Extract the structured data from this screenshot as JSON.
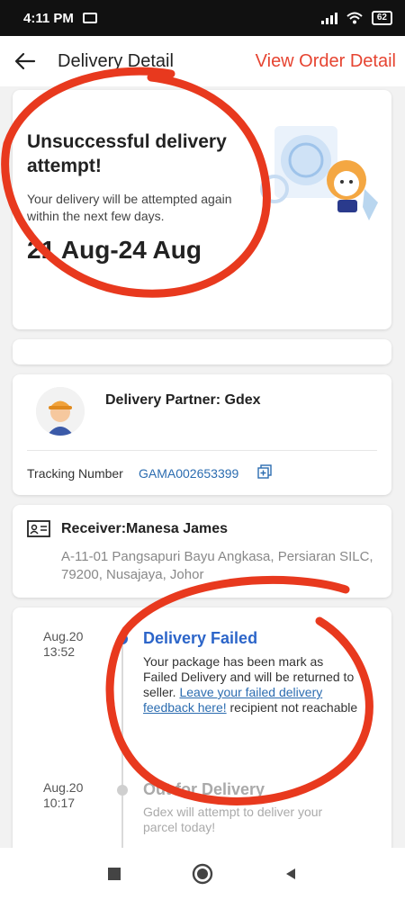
{
  "status_bar": {
    "time": "4:11 PM",
    "battery": "62"
  },
  "header": {
    "title": "Delivery Detail",
    "view_order_label": "View Order Detail"
  },
  "status_card": {
    "title": "Unsuccessful delivery attempt!",
    "subtitle": "Your delivery will be attempted again within the next few days.",
    "dates": "21 Aug-24 Aug"
  },
  "partner": {
    "name": "Delivery Partner: Gdex",
    "tracking_label": "Tracking Number",
    "tracking_number": "GAMA002653399"
  },
  "receiver": {
    "name": "Receiver:Manesa James",
    "address": "A-11-01 Pangsapuri Bayu Angkasa, Persiaran SILC, 79200, Nusajaya, Johor"
  },
  "timeline": {
    "events": [
      {
        "date": "Aug.20",
        "time": "13:52",
        "title": "Delivery Failed",
        "desc_pre": "Your package has been mark as Failed Delivery and will be returned to seller.",
        "link": "Leave your failed delivery feedback here!",
        "desc_post": "recipient not reachable"
      },
      {
        "date": "Aug.20",
        "time": "10:17",
        "title": "Out for Delivery",
        "desc": "Gdex will attempt to deliver your parcel today!"
      }
    ]
  },
  "colors": {
    "accent": "#e64431",
    "link": "#2b6cb0",
    "event_active": "#2c65c9",
    "annotation": "#e8391e"
  },
  "icons": [
    "back-arrow-icon",
    "copy-icon",
    "receiver-card-icon",
    "courier-avatar-icon",
    "stop-icon",
    "home-icon",
    "back-nav-icon"
  ]
}
